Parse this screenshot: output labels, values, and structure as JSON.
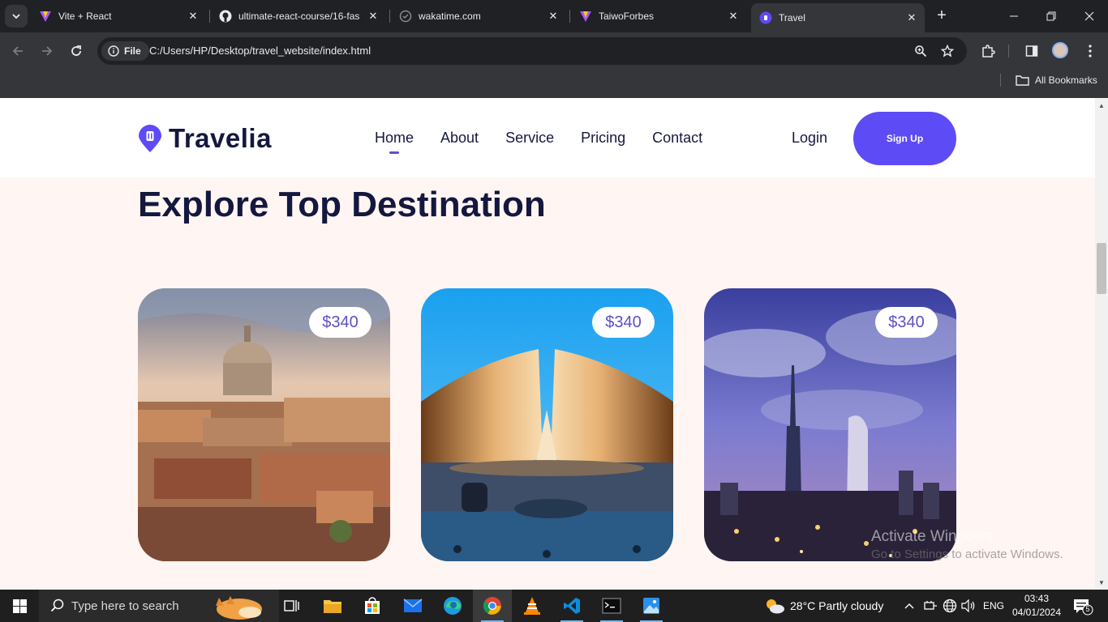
{
  "browser": {
    "tabs": [
      {
        "title": "Vite + React",
        "active": false
      },
      {
        "title": "ultimate-react-course/16-fas",
        "active": false
      },
      {
        "title": "wakatime.com",
        "active": false
      },
      {
        "title": "TaiwoForbes",
        "active": false
      },
      {
        "title": "Travel",
        "active": true
      }
    ],
    "address_chip": "File",
    "url": "C:/Users/HP/Desktop/travel_website/index.html",
    "bookmarks_label": "All Bookmarks"
  },
  "site": {
    "brand": "Travelia",
    "accent_color": "#5D50C6",
    "nav": [
      {
        "label": "Home",
        "active": true
      },
      {
        "label": "About",
        "active": false
      },
      {
        "label": "Service",
        "active": false
      },
      {
        "label": "Pricing",
        "active": false
      },
      {
        "label": "Contact",
        "active": false
      }
    ],
    "login_label": "Login",
    "signup_label": "Sign Up",
    "section_title": "Explore Top Destination",
    "cards": [
      {
        "price": "$340",
        "image": "rome-cityscape"
      },
      {
        "price": "$340",
        "image": "pakistan-monument"
      },
      {
        "price": "$340",
        "image": "dubai-skyline"
      }
    ],
    "watermark": {
      "line1": "Activate Windows",
      "line2": "Go to Settings to activate Windows."
    }
  },
  "taskbar": {
    "search_placeholder": "Type here to search",
    "weather": "28°C  Partly cloudy",
    "language": "ENG",
    "time": "03:43",
    "date": "04/01/2024",
    "notification_count": "5"
  }
}
